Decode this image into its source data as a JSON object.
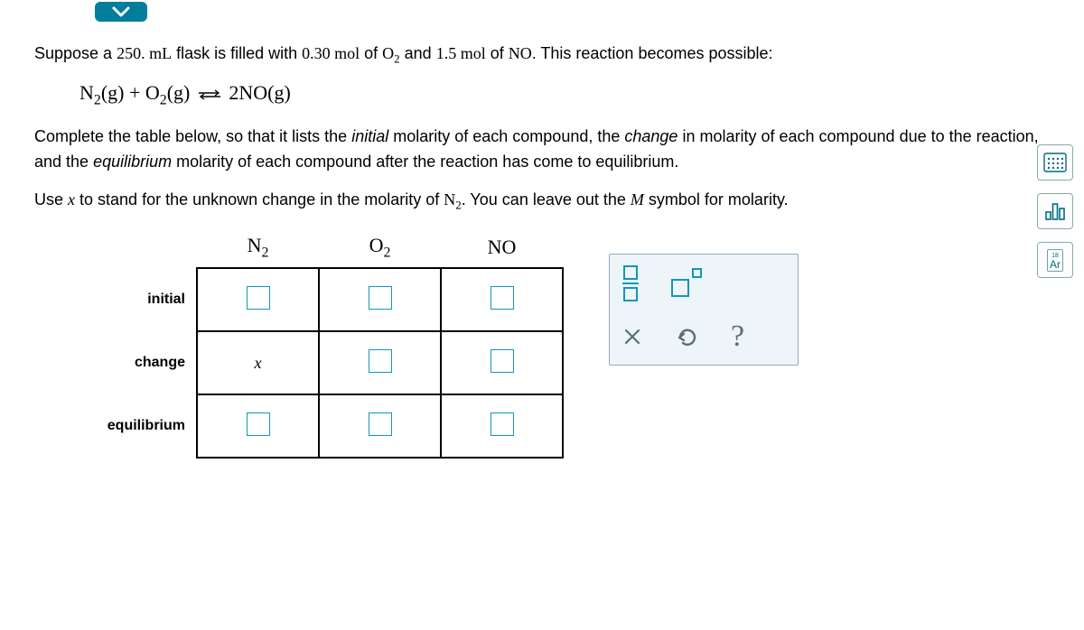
{
  "question": {
    "intro_prefix": "Suppose a ",
    "vol": "250. mL",
    "intro_mid1": " flask is filled with ",
    "molO2": "0.30 mol",
    "intro_mid2": " of ",
    "o2": "O",
    "intro_mid3": " and ",
    "molNO": "1.5 mol",
    "intro_mid4": " of ",
    "no": "NO",
    "intro_end": ". This reaction becomes possible:",
    "eq_n2": "N",
    "eq_g": "(g)",
    "eq_plus": "+",
    "eq_o2": "O",
    "eq_2no": "2NO",
    "para2a": "Complete the table below, so that it lists the ",
    "italic_initial": "initial",
    "para2b": " molarity of each compound, the ",
    "italic_change": "change",
    "para2c": " in molarity of each compound due to the reaction, and the ",
    "italic_eq": "equilibrium",
    "para2d": " molarity of each compound after the reaction has come to equilibrium.",
    "para3a": "Use ",
    "italic_x": "x",
    "para3b": " to stand for the unknown change in the molarity of ",
    "n2_label": "N",
    "para3c": ". You can leave out the ",
    "italic_M": "M",
    "para3d": " symbol for molarity."
  },
  "table": {
    "col1": "N",
    "col2": "O",
    "col3": "NO",
    "row1": "initial",
    "row2": "change",
    "row3": "equilibrium",
    "change_n2": "x"
  },
  "side": {
    "ar_num": "18",
    "ar_sym": "Ar"
  },
  "keypad": {
    "help": "?"
  }
}
